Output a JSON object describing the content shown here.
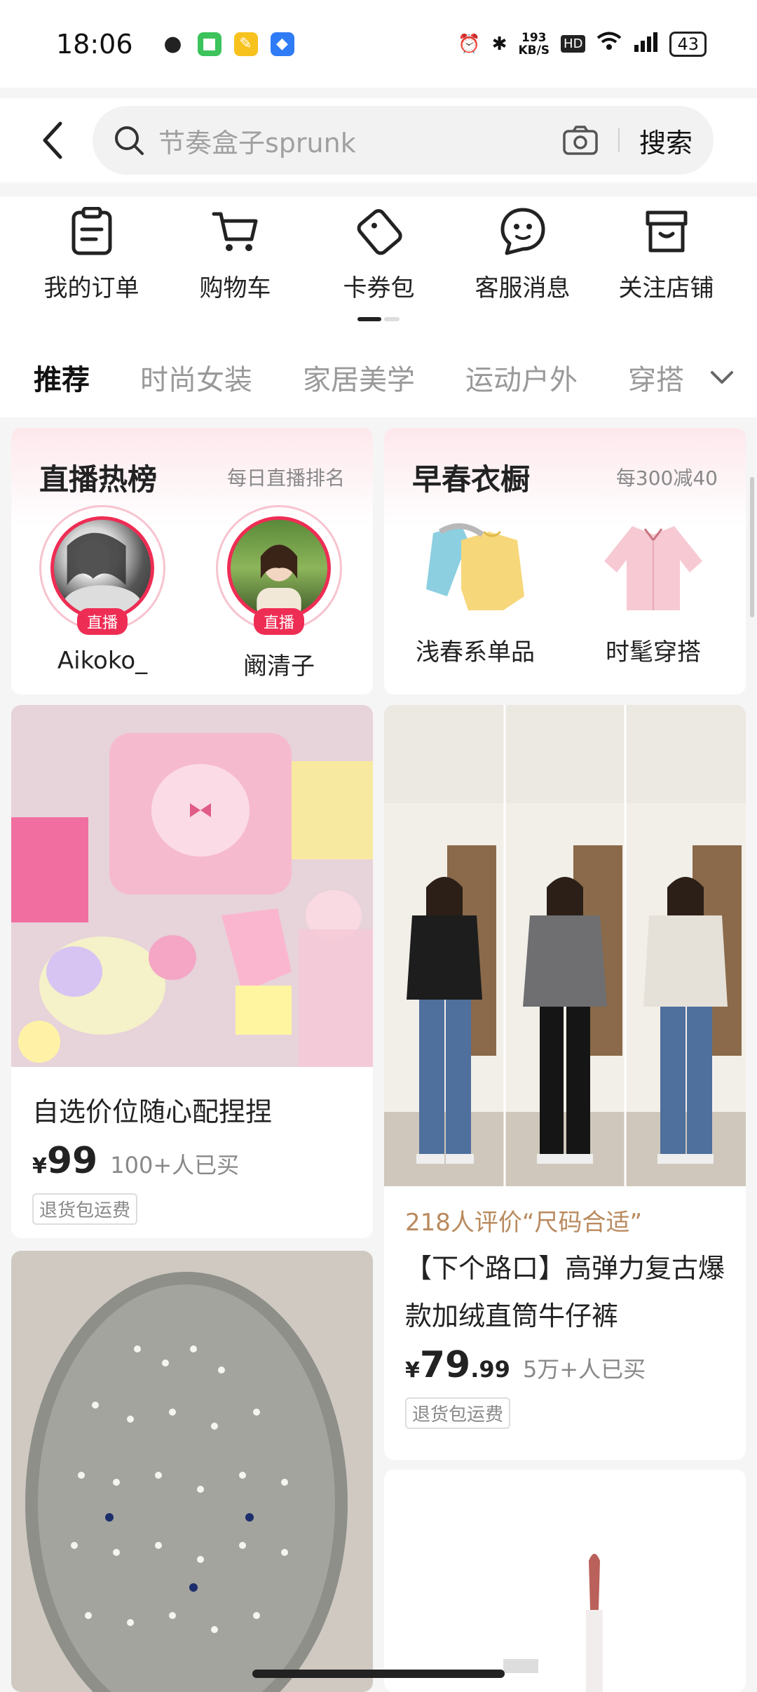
{
  "status": {
    "time": "18:06",
    "speed": "193",
    "speed_unit": "KB/S",
    "battery": "43"
  },
  "search": {
    "placeholder": "节奏盒子sprunk",
    "button": "搜索"
  },
  "quick_links": [
    {
      "label": "我的订单",
      "icon": "clipboard-icon"
    },
    {
      "label": "购物车",
      "icon": "cart-icon"
    },
    {
      "label": "卡券包",
      "icon": "coupon-icon"
    },
    {
      "label": "客服消息",
      "icon": "chat-icon"
    },
    {
      "label": "关注店铺",
      "icon": "store-icon"
    }
  ],
  "tabs": [
    "推荐",
    "时尚女装",
    "家居美学",
    "运动户外",
    "穿搭"
  ],
  "promo_live": {
    "title": "直播热榜",
    "subtitle": "每日直播排名",
    "badge": "直播",
    "streamers": [
      "Aikoko_",
      "阚清子"
    ]
  },
  "promo_spring": {
    "title": "早春衣橱",
    "subtitle": "每300减40",
    "items": [
      "浅春系单品",
      "时髦穿搭"
    ]
  },
  "products": [
    {
      "title": "自选价位随心配捏捏",
      "price_symbol": "¥",
      "price_int": "99",
      "price_dec": "",
      "sold": "100+人已买",
      "tag": "退货包运费"
    },
    {
      "review": "218人评价“尺码合适”",
      "title": "【下个路口】高弹力复古爆款加绒直筒牛仔裤",
      "price_symbol": "¥",
      "price_int": "79",
      "price_dec": ".99",
      "sold": "5万+人已买",
      "tag": "退货包运费"
    }
  ],
  "colors": {
    "live_red": "#ee2d54",
    "review_gold": "#b98a5e"
  }
}
